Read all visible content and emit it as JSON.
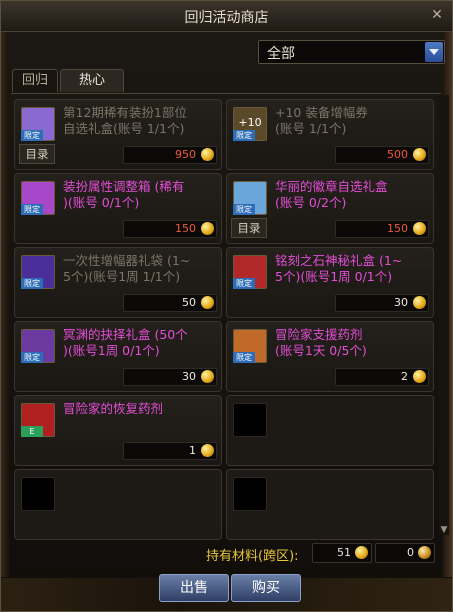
{
  "window": {
    "title": "回归活动商店",
    "close_icon": "✕"
  },
  "filter": {
    "selected": "全部"
  },
  "tabs": [
    {
      "label": "回归"
    },
    {
      "label": "热心"
    }
  ],
  "items": [
    {
      "name": "第12期稀有装扮1部位\n自选礼盒(账号 1/1个)",
      "price": "950",
      "price_color": "red",
      "name_style": "gray",
      "has_catalog": true,
      "catalog_label": "目录",
      "icon_color": "#8a6ad0",
      "icon": "gift-box-icon",
      "badge": "限定"
    },
    {
      "name": "+10 装备增幅券\n(账号 1/1个)",
      "price": "500",
      "price_color": "red",
      "name_style": "gray",
      "has_catalog": false,
      "icon_color": "#5a4a2a",
      "icon": "amplify-ticket-icon",
      "badge": "限定",
      "icon_text": "+10"
    },
    {
      "name": "装扮属性调整箱 (稀有\n)(账号 0/1个)",
      "price": "150",
      "price_color": "red",
      "name_style": "pink",
      "has_catalog": false,
      "icon_color": "#a848c8",
      "icon": "purple-box-icon",
      "badge": "限定"
    },
    {
      "name": "华丽的徽章自选礼盒\n(账号 0/2个)",
      "price": "150",
      "price_color": "red",
      "name_style": "pink",
      "has_catalog": true,
      "catalog_label": "目录",
      "icon_color": "#6aa6d8",
      "icon": "emblem-box-icon",
      "badge": "限定"
    },
    {
      "name": "一次性增幅器礼袋 (1~\n5个)(账号1周 1/1个)",
      "price": "50",
      "price_color": "white",
      "name_style": "gray",
      "has_catalog": false,
      "icon_color": "#4a2f9a",
      "icon": "amplifier-bag-icon",
      "badge": "限定"
    },
    {
      "name": "铭刻之石神秘礼盒 (1~\n5个)(账号1周 0/1个)",
      "price": "30",
      "price_color": "white",
      "name_style": "pink",
      "has_catalog": false,
      "icon_color": "#b02828",
      "icon": "stone-box-icon",
      "badge": "限定"
    },
    {
      "name": "冥渊的抉择礼盒 (50个\n)(账号1周 0/1个)",
      "price": "30",
      "price_color": "white",
      "name_style": "pink",
      "has_catalog": false,
      "icon_color": "#6a3aa0",
      "icon": "abyss-box-icon",
      "badge": "限定"
    },
    {
      "name": "冒险家支援药剂\n(账号1天 0/5个)",
      "price": "2",
      "price_color": "white",
      "name_style": "pink",
      "has_catalog": false,
      "icon_color": "#c06a2a",
      "icon": "support-potion-icon",
      "badge": "限定"
    },
    {
      "name": "冒险家的恢复药剂",
      "price": "1",
      "price_color": "white",
      "name_style": "pink",
      "has_catalog": false,
      "icon_color": "#b02020",
      "icon": "recovery-potion-icon",
      "badge": "E"
    }
  ],
  "footer": {
    "label": "持有材料(跨区):",
    "amount_1": "51",
    "amount_2": "0",
    "sell_label": "出售",
    "buy_label": "购买"
  }
}
